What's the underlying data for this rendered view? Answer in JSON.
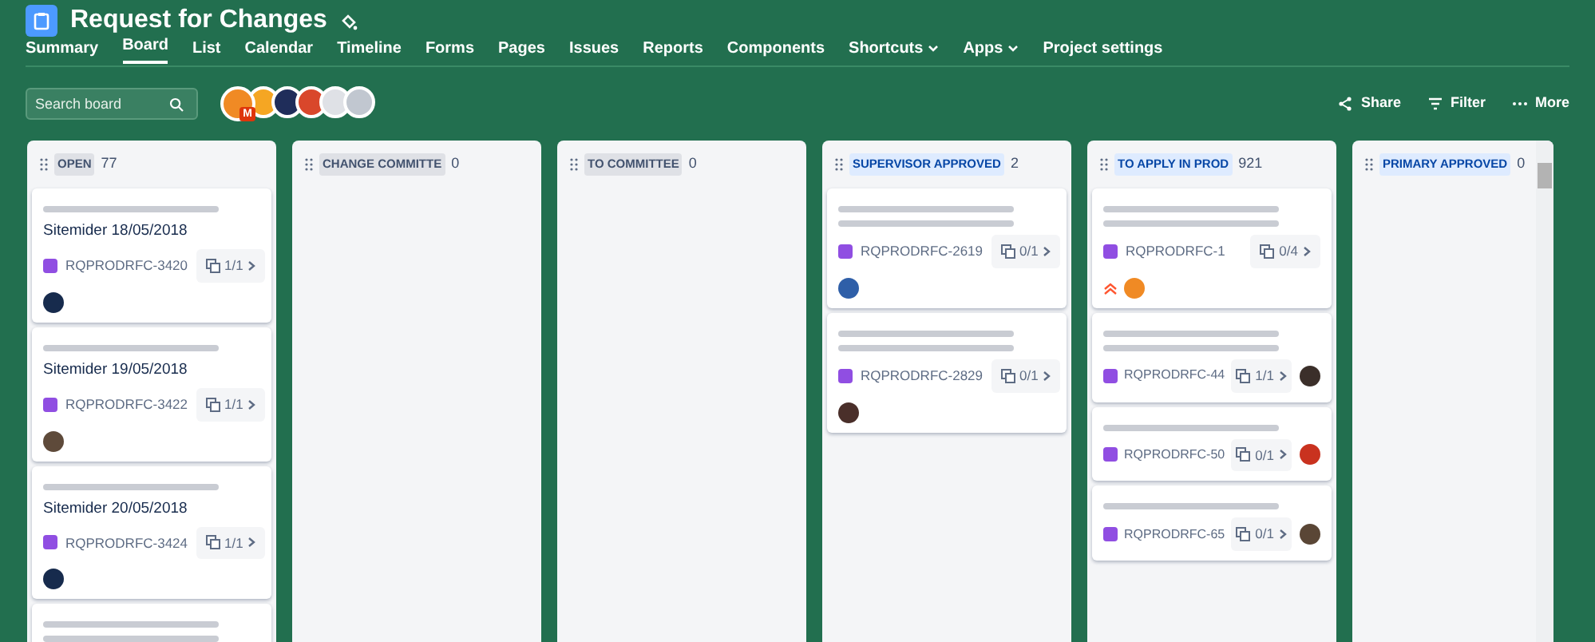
{
  "project": {
    "title": "Request for Changes"
  },
  "tabs": [
    {
      "label": "Summary",
      "selected": false,
      "dropdown": false
    },
    {
      "label": "Board",
      "selected": true,
      "dropdown": false
    },
    {
      "label": "List",
      "selected": false,
      "dropdown": false
    },
    {
      "label": "Calendar",
      "selected": false,
      "dropdown": false
    },
    {
      "label": "Timeline",
      "selected": false,
      "dropdown": false
    },
    {
      "label": "Forms",
      "selected": false,
      "dropdown": false
    },
    {
      "label": "Pages",
      "selected": false,
      "dropdown": false
    },
    {
      "label": "Issues",
      "selected": false,
      "dropdown": false
    },
    {
      "label": "Reports",
      "selected": false,
      "dropdown": false
    },
    {
      "label": "Components",
      "selected": false,
      "dropdown": false
    },
    {
      "label": "Shortcuts",
      "selected": false,
      "dropdown": true
    },
    {
      "label": "Apps",
      "selected": false,
      "dropdown": true
    },
    {
      "label": "Project settings",
      "selected": false,
      "dropdown": false
    }
  ],
  "search": {
    "placeholder": "Search board"
  },
  "people": [
    {
      "color": "#f08a24",
      "badge": "M"
    },
    {
      "color": "#f5a623"
    },
    {
      "color": "#1f2d5a"
    },
    {
      "color": "#d9472b"
    },
    {
      "color": "#dfe1e6"
    },
    {
      "color": "#c1c7d0"
    }
  ],
  "actions": [
    {
      "kind": "share",
      "label": "Share"
    },
    {
      "kind": "filter",
      "label": "Filter"
    },
    {
      "kind": "more",
      "label": "More"
    }
  ],
  "columns": [
    {
      "name": "OPEN",
      "count": "77",
      "color": "#dfe1e6",
      "cards": [
        {
          "kind": "stacked",
          "lines": [
            {
              "kind": "blurred"
            },
            {
              "kind": "text",
              "text": "Sitemider 18/05/2018"
            }
          ],
          "key": "RQPRODRFC-3420",
          "subtasks": "1/1",
          "priority": false,
          "avatars": [
            {
              "color": "#172b4d"
            }
          ]
        },
        {
          "kind": "stacked",
          "lines": [
            {
              "kind": "blurred"
            },
            {
              "kind": "text",
              "text": "Sitemider 19/05/2018"
            }
          ],
          "key": "RQPRODRFC-3422",
          "subtasks": "1/1",
          "priority": false,
          "avatars": [
            {
              "color": "#5e4a3a"
            }
          ]
        },
        {
          "kind": "stacked",
          "lines": [
            {
              "kind": "blurred"
            },
            {
              "kind": "text",
              "text": "Sitemider 20/05/2018"
            }
          ],
          "key": "RQPRODRFC-3424",
          "subtasks": "1/1",
          "priority": false,
          "avatars": [
            {
              "color": "#172b4d"
            }
          ]
        },
        {
          "kind": "stub",
          "lines": [
            {
              "kind": "blurred"
            },
            {
              "kind": "blurred"
            }
          ]
        }
      ]
    },
    {
      "name": "CHANGE COMMITTE",
      "count": "0",
      "color": "#dfe1e6"
    },
    {
      "name": "TO COMMITTEE",
      "count": "0",
      "color": "#dfe1e6"
    },
    {
      "name": "SUPERVISOR APPROVED",
      "count": "2",
      "color": "#deebff",
      "cards": [
        {
          "kind": "stacked",
          "lines": [
            {
              "kind": "blurred"
            },
            {
              "kind": "blurred"
            }
          ],
          "key": "RQPRODRFC-2619",
          "subtasks": "0/1",
          "priority": false,
          "avatars": [
            {
              "color": "#2f5fa8"
            }
          ]
        },
        {
          "kind": "stacked",
          "lines": [
            {
              "kind": "blurred"
            },
            {
              "kind": "blurred"
            }
          ],
          "key": "RQPRODRFC-2829",
          "subtasks": "0/1",
          "priority": false,
          "avatars": [
            {
              "color": "#4a2f2a"
            }
          ]
        }
      ]
    },
    {
      "name": "TO APPLY IN PROD",
      "count": "921",
      "color": "#deebff",
      "cards": [
        {
          "kind": "stacked",
          "lines": [
            {
              "kind": "blurred"
            },
            {
              "kind": "blurred"
            }
          ],
          "key": "RQPRODRFC-1",
          "subtasks": "0/4",
          "priority": true,
          "avatars": [
            {
              "color": "#f08a24"
            }
          ]
        },
        {
          "kind": "inline",
          "lines": [
            {
              "kind": "blurred"
            },
            {
              "kind": "blurred"
            }
          ],
          "key": "RQPRODRFC-44",
          "subtasks": "1/1",
          "priority": false,
          "avatars": [
            {
              "color": "#3b2f2a"
            }
          ]
        },
        {
          "kind": "inline",
          "lines": [
            {
              "kind": "blurred"
            }
          ],
          "key": "RQPRODRFC-50",
          "subtasks": "0/1",
          "priority": false,
          "avatars": [
            {
              "color": "#c9321f"
            }
          ]
        },
        {
          "kind": "inline",
          "lines": [
            {
              "kind": "blurred"
            }
          ],
          "key": "RQPRODRFC-65",
          "subtasks": "0/1",
          "priority": false,
          "avatars": [
            {
              "color": "#5a4636"
            }
          ]
        }
      ]
    },
    {
      "name": "PRIMARY APPROVED",
      "count": "0",
      "color": "#deebff"
    }
  ]
}
